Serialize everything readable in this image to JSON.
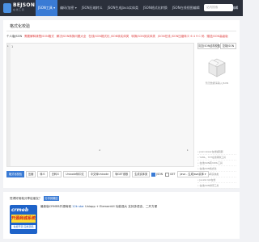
{
  "brand": {
    "name": "BEJSON",
    "tagline": "在线工具"
  },
  "nav": {
    "items": [
      {
        "label": "JSON工具 ▾",
        "active": true
      },
      {
        "label": "编码/加密 ▾"
      },
      {
        "label": "JSON压缩转义"
      },
      {
        "label": "JSON生成Java实体类"
      },
      {
        "label": "JSON格式化转换"
      },
      {
        "label": "JSON在线视图编辑"
      },
      {
        "label": "JSON解析"
      },
      {
        "label": "JSON编辑"
      }
    ],
    "search_placeholder": "站内搜索",
    "search_icon": "search-icon"
  },
  "page": {
    "title": "格式化校验"
  },
  "links": [
    {
      "text": "个人版JSON",
      "color": "plain"
    },
    {
      "text": "需要解释清楚JSON格式",
      "color": "red"
    },
    {
      "text": "解决JSON转换问题大全",
      "color": "red"
    },
    {
      "text": "在线JSON格式化 JSON转实体类",
      "color": "red"
    },
    {
      "text": "转换JSON到实体类",
      "color": "red"
    },
    {
      "text": "JSON在线 JSON压缩转义 6 4 9 C 码",
      "color": "red"
    },
    {
      "text": "赠送JSON高级版",
      "color": "red"
    }
  ],
  "editor": {
    "gutter_fold": "▸",
    "first_line": "1"
  },
  "side": {
    "btn_left": "清空JSON结构校验",
    "btn_right": "复制JSON",
    "box_caption": "暂无数据请输入JSON",
    "list": [
      "• Jsonviewer在线编辑器",
      "• YAML，TXT在线转换工具",
      "• 在线JSON转YAML工具",
      "• 在线JSON格式化",
      "• 在线JSON转实体类",
      "• JavaScript在线",
      "• 在线JSON排序工具"
    ]
  },
  "toolbar": {
    "buttons": [
      {
        "label": "格式化校验",
        "primary": true
      },
      {
        "label": "压缩"
      },
      {
        "label": "转义"
      },
      {
        "label": "去转义"
      },
      {
        "label": "Unicode转中文"
      },
      {
        "label": "中文转Unicode"
      },
      {
        "label": "转GET参数"
      },
      {
        "label": "生成实体类"
      }
    ],
    "toggle_label": "JSON",
    "toggle2_label": "GET",
    "select_label": "Java - 生成Java实体 ▾"
  },
  "share": {
    "text": "觉得好用就分享给朋友？",
    "button": "分享到微信"
  },
  "ad": {
    "brand": "crmeb",
    "banner": "开源商城系统",
    "tag": "免费开源 完整源码",
    "text_prefix": "最新版CRMEB开源商城",
    "text_highlight": "12k star",
    "text_suffix": " Uniapp + ElementUI 功能强大 支持多语言、二开方便"
  }
}
